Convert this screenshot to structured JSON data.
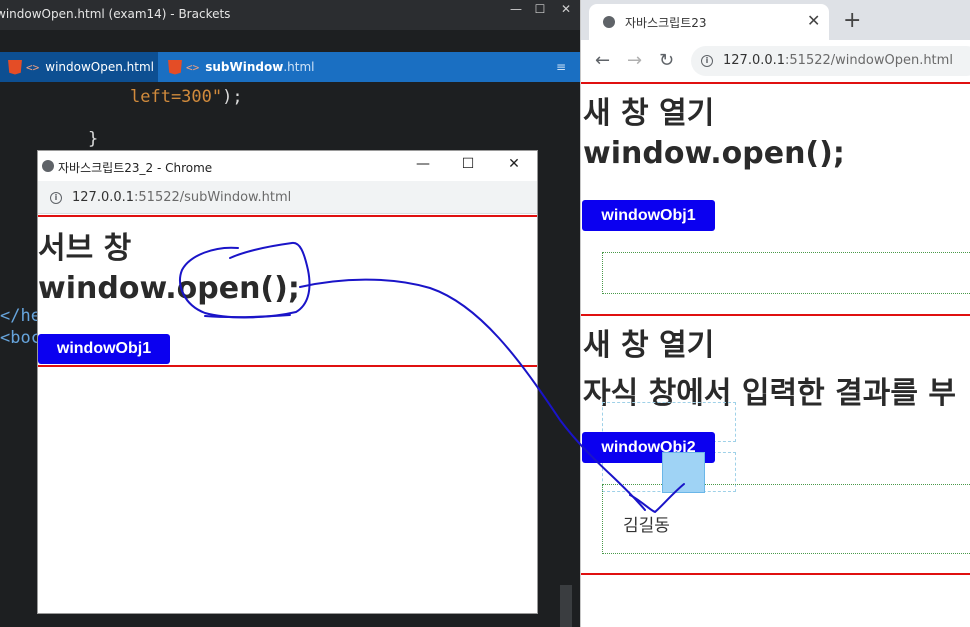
{
  "editor": {
    "title": "windowOpen.html (exam14) - Brackets",
    "window_controls": {
      "minimize": "—",
      "maximize": "☐",
      "close": "✕"
    },
    "tabs": [
      {
        "label": "windowOpen.html",
        "active": true
      },
      {
        "label_bold": "subWindow",
        "label_ext": ".html",
        "active": false
      }
    ],
    "tab_menu_glyph": "≡",
    "code": {
      "line1_value": "left=300\"",
      "line1_punct": ");",
      "line2": "}",
      "line3": "</he",
      "line4": "<boc"
    }
  },
  "popup": {
    "title": "자바스크립트23_2 - Chrome",
    "window_controls": {
      "minimize": "—",
      "maximize": "☐",
      "close": "✕"
    },
    "url_host": "127.0.0.1",
    "url_rest": ":51522/subWindow.html",
    "heading1": "서브 창",
    "heading2": "window.open();",
    "button": "windowObj1"
  },
  "chrome": {
    "tab_title": "자바스크립트23",
    "tab_close": "✕",
    "new_tab": "+",
    "nav": {
      "back": "←",
      "forward": "→",
      "reload": "↻"
    },
    "url_host": "127.0.0.1",
    "url_rest": ":51522/windowOpen.html",
    "section1": {
      "heading1": "새 창 열기",
      "heading2": "window.open();",
      "button": "windowObj1"
    },
    "section2": {
      "heading1": "새 창 열기",
      "heading2": "자식 창에서 입력한 결과를 부",
      "button": "windowObj2",
      "result_text": "김길동"
    }
  },
  "colors": {
    "editor_bg": "#1d1f21",
    "tabbar": "#1a6fc2",
    "button_blue": "#0b00f0",
    "rule_red": "#e01010",
    "ink_blue": "#1a14c8"
  }
}
